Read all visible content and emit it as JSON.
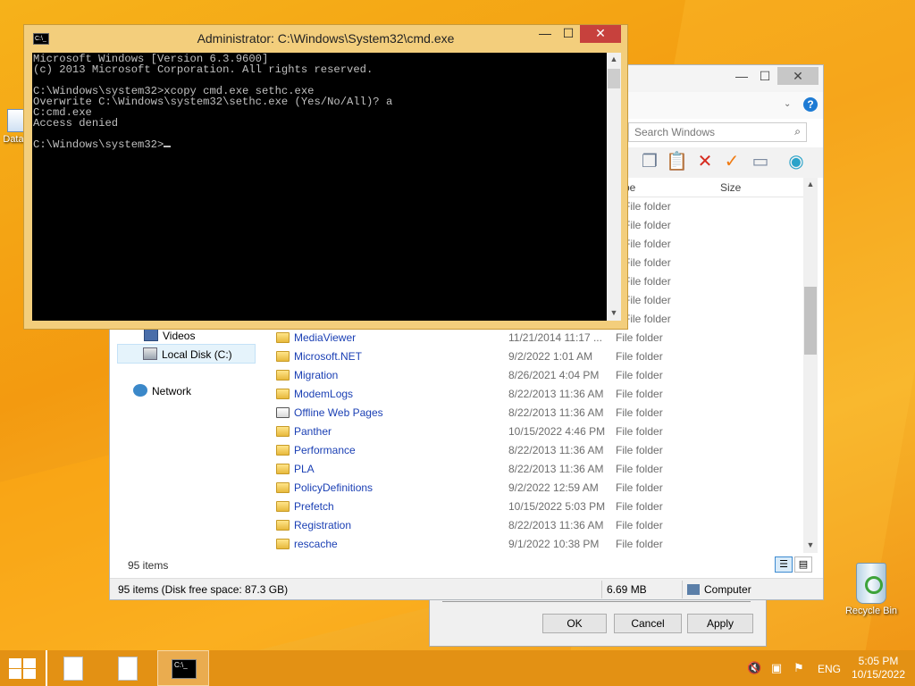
{
  "desktop": {
    "icons": [
      {
        "label": "Data"
      },
      {
        "label": "Recycle Bin"
      }
    ]
  },
  "cmd": {
    "title": "Administrator: C:\\Windows\\System32\\cmd.exe",
    "lines": [
      "Microsoft Windows [Version 6.3.9600]",
      "(c) 2013 Microsoft Corporation. All rights reserved.",
      "",
      "C:\\Windows\\system32>xcopy cmd.exe sethc.exe",
      "Overwrite C:\\Windows\\system32\\sethc.exe (Yes/No/All)? a",
      "C:cmd.exe",
      "Access denied",
      "",
      "C:\\Windows\\system32>"
    ],
    "controls": {
      "minimize": "—",
      "maximize": "☐",
      "close": "✕"
    }
  },
  "explorer": {
    "controls": {
      "minimize": "—",
      "maximize": "☐",
      "close": "✕"
    },
    "help_icon": "?",
    "search_placeholder": "Search Windows",
    "toolbar_icons": [
      "copy-icon",
      "paste-icon",
      "delete-icon",
      "properties-check-icon",
      "rename-icon",
      "globe-icon"
    ],
    "columns": {
      "type": "pe",
      "size": "Size"
    },
    "ghost_types": [
      "File folder",
      "File folder",
      "File folder",
      "File folder",
      "File folder",
      "File folder",
      "File folder"
    ],
    "nav": [
      {
        "label": "Videos",
        "icon": "videos-icon"
      },
      {
        "label": "Local Disk (C:)",
        "icon": "disk-icon"
      },
      {
        "label": "Network",
        "icon": "network-icon"
      }
    ],
    "files": [
      {
        "name": "MediaViewer",
        "date": "11/21/2014 11:17 ...",
        "type": "File folder"
      },
      {
        "name": "Microsoft.NET",
        "date": "9/2/2022 1:01 AM",
        "type": "File folder"
      },
      {
        "name": "Migration",
        "date": "8/26/2021 4:04 PM",
        "type": "File folder"
      },
      {
        "name": "ModemLogs",
        "date": "8/22/2013 11:36 AM",
        "type": "File folder"
      },
      {
        "name": "Offline Web Pages",
        "date": "8/22/2013 11:36 AM",
        "type": "File folder"
      },
      {
        "name": "Panther",
        "date": "10/15/2022 4:46 PM",
        "type": "File folder"
      },
      {
        "name": "Performance",
        "date": "8/22/2013 11:36 AM",
        "type": "File folder"
      },
      {
        "name": "PLA",
        "date": "8/22/2013 11:36 AM",
        "type": "File folder"
      },
      {
        "name": "PolicyDefinitions",
        "date": "9/2/2022 12:59 AM",
        "type": "File folder"
      },
      {
        "name": "Prefetch",
        "date": "10/15/2022 5:03 PM",
        "type": "File folder"
      },
      {
        "name": "Registration",
        "date": "8/22/2013 11:36 AM",
        "type": "File folder"
      },
      {
        "name": "rescache",
        "date": "9/1/2022 10:38 PM",
        "type": "File folder"
      }
    ],
    "items_count": "95 items",
    "status": {
      "left": "95 items (Disk free space: 87.3 GB)",
      "size": "6.69 MB",
      "location": "Computer"
    }
  },
  "dialog": {
    "ok": "OK",
    "cancel": "Cancel",
    "apply": "Apply"
  },
  "taskbar": {
    "language": "ENG",
    "time": "5:05 PM",
    "date": "10/15/2022"
  }
}
